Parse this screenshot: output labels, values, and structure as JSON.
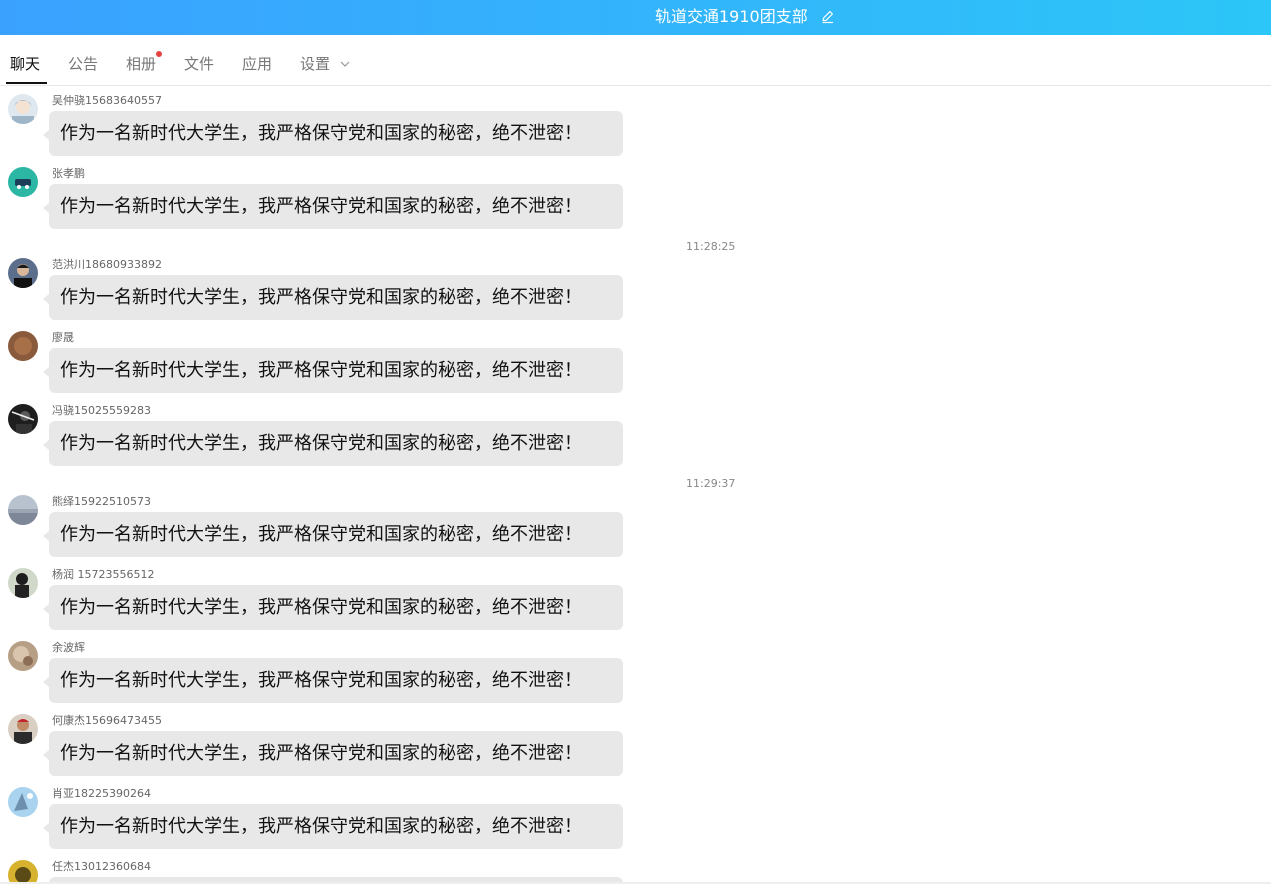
{
  "header": {
    "title": "轨道交通1910团支部",
    "edit_icon": "edit-pencil-icon",
    "gradient_colors": [
      "#3aa1ff",
      "#2cc6f8"
    ]
  },
  "tabs": [
    {
      "label": "聊天",
      "active": true
    },
    {
      "label": "公告"
    },
    {
      "label": "相册",
      "badge": "red-dot"
    },
    {
      "label": "文件"
    },
    {
      "label": "应用"
    },
    {
      "label": "设置",
      "icon": "chevron-down-icon"
    }
  ],
  "timestamps": [
    "11:28:25",
    "11:29:37"
  ],
  "messages": [
    {
      "sender": "吴仲骁15683640557",
      "text": "作为一名新时代大学生，我严格保守党和国家的秘密，绝不泄密！"
    },
    {
      "sender": "张孝鹏",
      "text": "作为一名新时代大学生，我严格保守党和国家的秘密，绝不泄密！"
    },
    {
      "sender": "范洪川18680933892",
      "text": "作为一名新时代大学生，我严格保守党和国家的秘密，绝不泄密！"
    },
    {
      "sender": "廖晟",
      "text": "作为一名新时代大学生，我严格保守党和国家的秘密，绝不泄密！"
    },
    {
      "sender": "冯骁15025559283",
      "text": "作为一名新时代大学生，我严格保守党和国家的秘密，绝不泄密！"
    },
    {
      "sender": "熊绎15922510573",
      "text": "作为一名新时代大学生，我严格保守党和国家的秘密，绝不泄密！"
    },
    {
      "sender": "杨润 15723556512",
      "text": "作为一名新时代大学生，我严格保守党和国家的秘密，绝不泄密！"
    },
    {
      "sender": "余波辉",
      "text": "作为一名新时代大学生，我严格保守党和国家的秘密，绝不泄密！"
    },
    {
      "sender": "何康杰15696473455",
      "text": "作为一名新时代大学生，我严格保守党和国家的秘密，绝不泄密！"
    },
    {
      "sender": "肖亚18225390264",
      "text": "作为一名新时代大学生，我严格保守党和国家的秘密，绝不泄密！"
    },
    {
      "sender": "任杰13012360684",
      "text": ""
    }
  ]
}
